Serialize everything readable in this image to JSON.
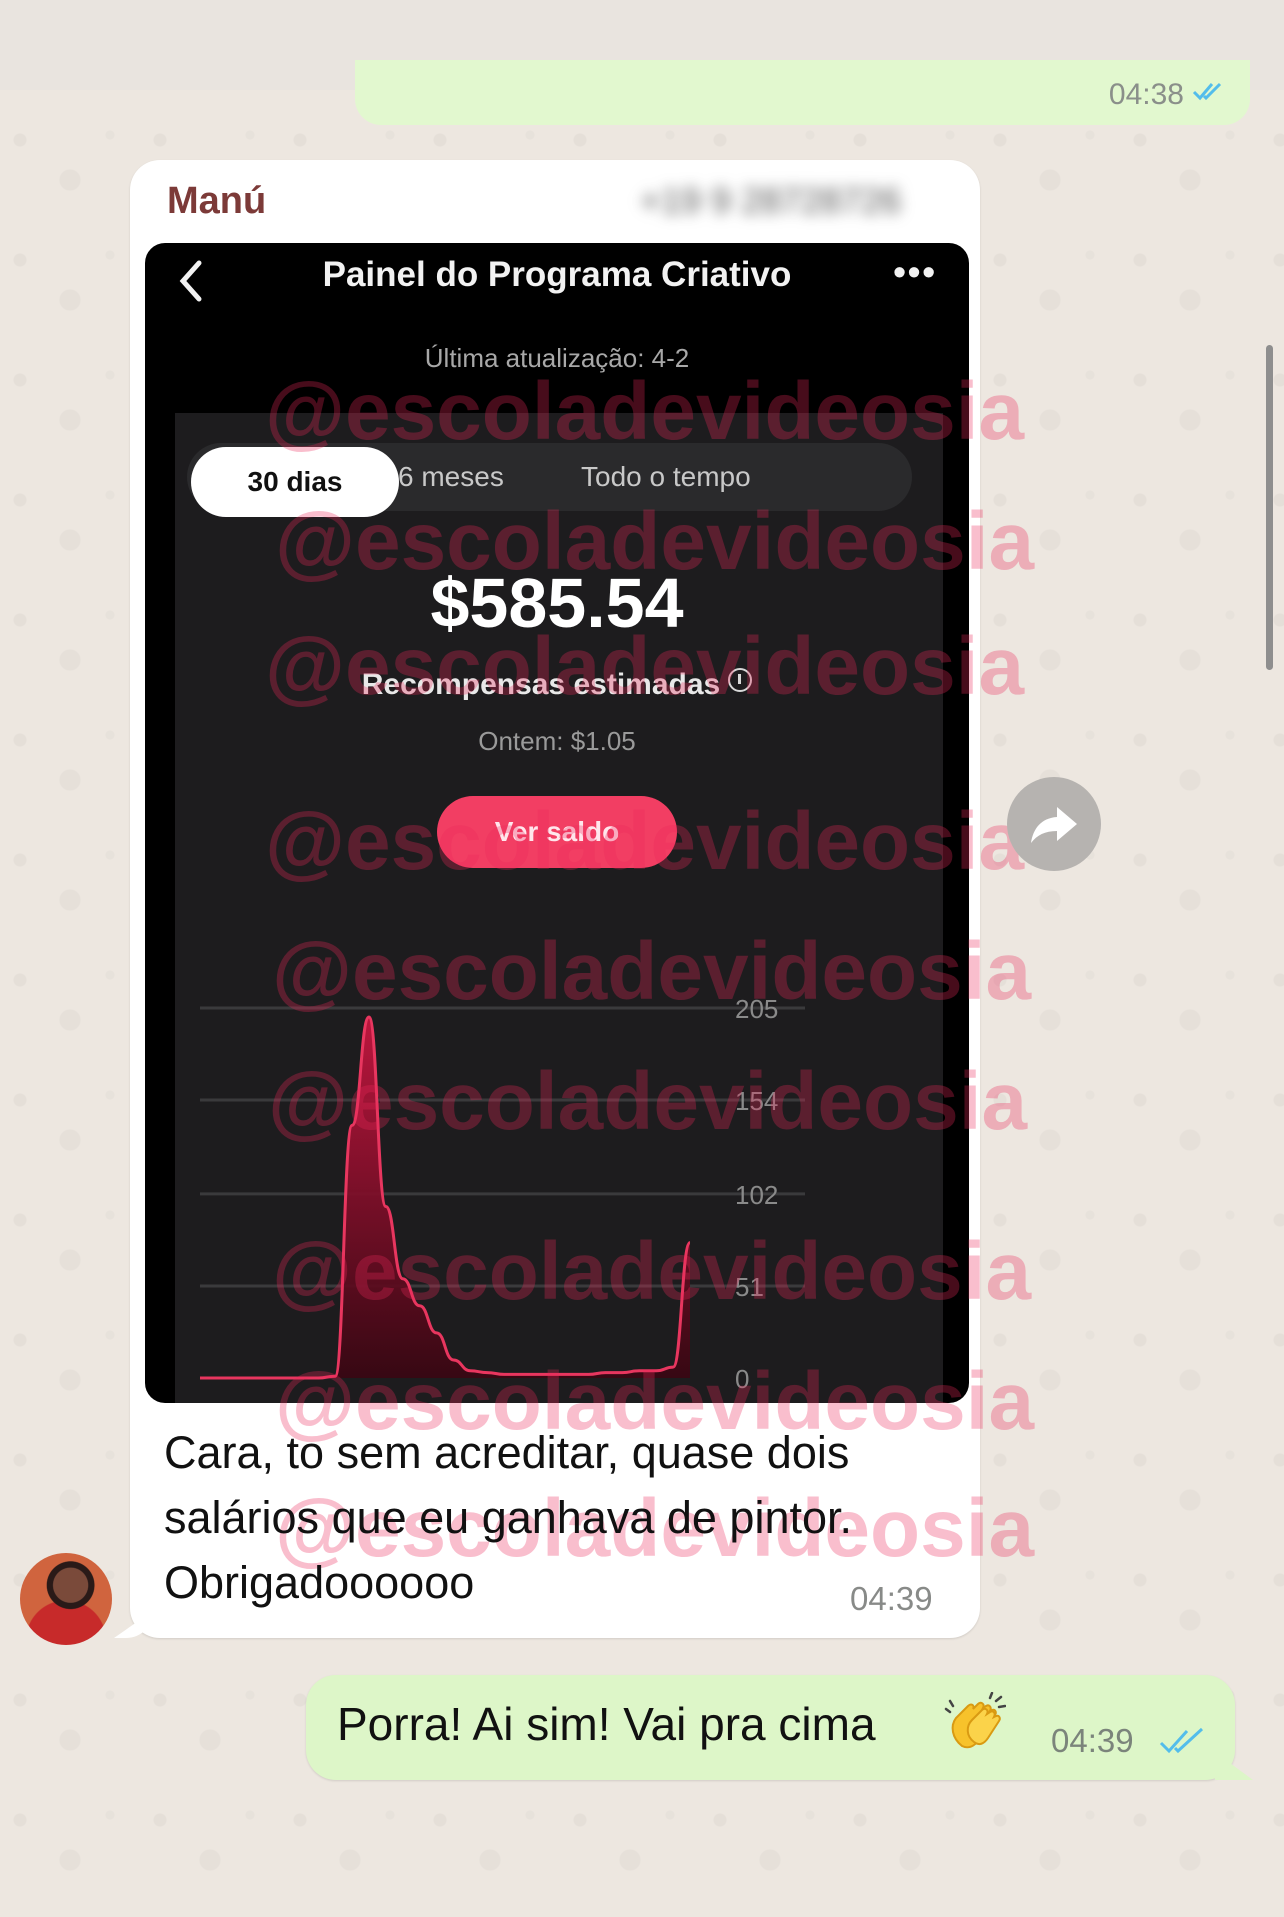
{
  "previous_message": {
    "time": "04:38",
    "ticks_icon": "double-check-read-icon"
  },
  "incoming": {
    "sender_name": "Manú",
    "sender_phone": "+19 9 28728726",
    "avatar_icon": "contact-avatar",
    "forward_icon": "forward-arrow-icon",
    "image": {
      "back_icon": "chevron-left-icon",
      "title": "Painel do Programa Criativo",
      "more_icon": "more-dots-icon",
      "more_label": "•••",
      "last_updated": "Última atualização: 4-2",
      "tabs": [
        {
          "label": "30 dias",
          "active": true
        },
        {
          "label": "6 meses",
          "active": false
        },
        {
          "label": "Todo o tempo",
          "active": false
        }
      ],
      "amount": "$585.54",
      "amount_label": "Recompensas estimadas",
      "yesterday": "Ontem: $1.05",
      "button_label": "Ver saldo",
      "accent_color": "#f23e63"
    },
    "text_lines": [
      "Cara, to sem acreditar, quase dois",
      "salários que eu ganhava de pintor.",
      "Obrigadoooooo"
    ],
    "time": "04:39"
  },
  "chart_data": {
    "type": "area",
    "title": "",
    "xlabel": "",
    "ylabel": "",
    "ylim": [
      0,
      205
    ],
    "yticks": [
      205,
      154,
      102,
      51,
      0
    ],
    "x": [
      1,
      2,
      3,
      4,
      5,
      6,
      7,
      8,
      9,
      10,
      11,
      12,
      13,
      14,
      15,
      16,
      17,
      18,
      19,
      20,
      21,
      22,
      23,
      24,
      25,
      26,
      27,
      28,
      29,
      30
    ],
    "series": [
      {
        "values": [
          0,
          0,
          0,
          0,
          0,
          0,
          0,
          0,
          1,
          140,
          200,
          95,
          55,
          40,
          25,
          10,
          4,
          3,
          2,
          2,
          2,
          2,
          2,
          2,
          3,
          3,
          4,
          4,
          6,
          75
        ],
        "color": "#e8365f"
      }
    ],
    "grid": true
  },
  "watermark": "@escoladevideosia",
  "outgoing": {
    "text": "Porra! Ai sim! Vai pra cima",
    "emoji_icon": "clapping-hands-icon",
    "time": "04:39",
    "ticks_icon": "double-check-read-icon",
    "ticks_color": "#53bdeb"
  }
}
